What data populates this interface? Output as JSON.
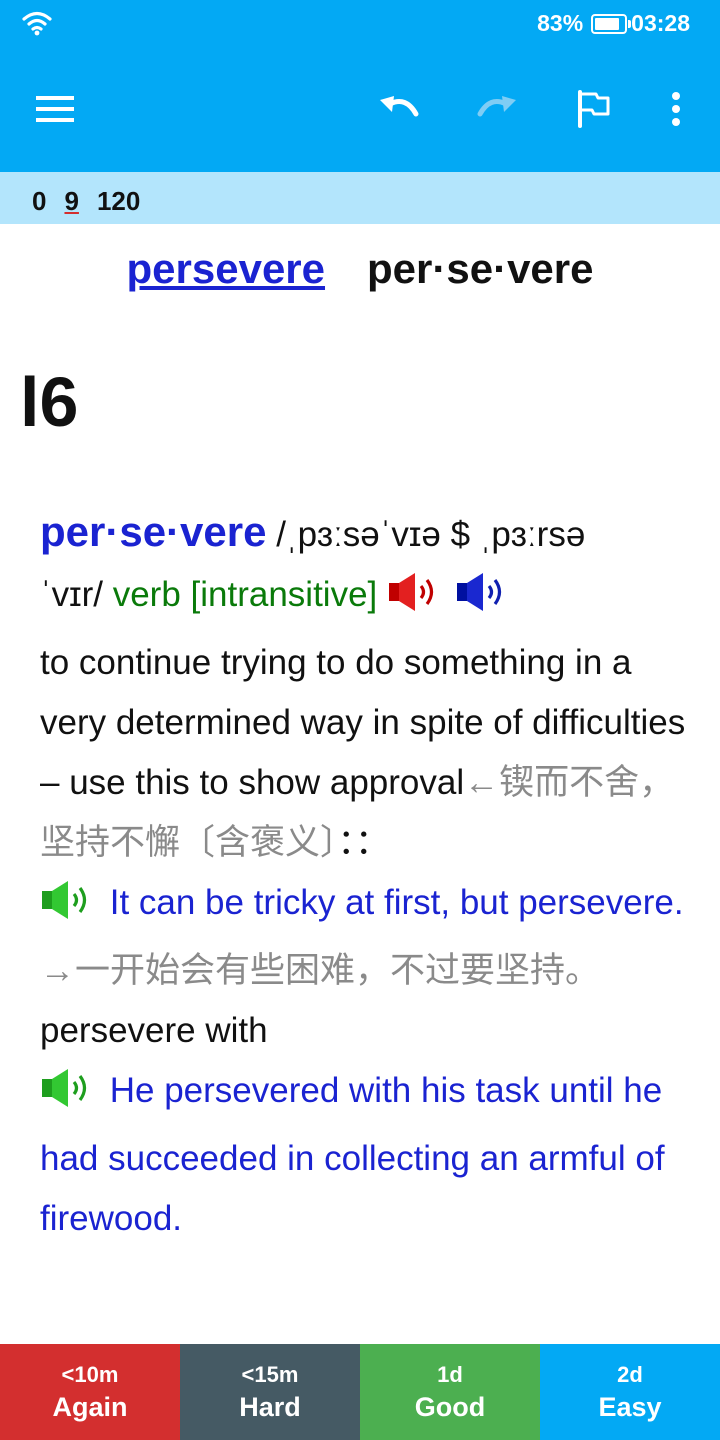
{
  "status": {
    "battery_percent": "83%",
    "battery_level": 0.83,
    "time": "03:28"
  },
  "toolbar": {
    "icons": [
      "menu-icon",
      "undo-icon",
      "redo-icon",
      "flag-icon",
      "more-vert-icon"
    ],
    "accent_color": "#03a9f4"
  },
  "counts": {
    "new": "0",
    "learning": "9",
    "review": "120"
  },
  "card": {
    "word": "persevere",
    "word_syllables": "per·se·vere",
    "level": "l6",
    "headword": "per·se·vere",
    "pron_1": " /ˌpɜːsəˈvɪə $ ˌpɜːrsə",
    "pron_2": "ˈvɪr/ ",
    "pos": "verb [intransitive]",
    "definition": "to continue trying to do something in a very determined way in spite of difficulties – use this to show approval",
    "definition_cn": "←锲而不舍，坚持不懈〔含褒义〕",
    "colons": "：：",
    "example_1": " It can be tricky at first, but persevere.",
    "example_1_cn": "→一开始会有些困难，不过要坚持。",
    "phrase": "persevere with",
    "example_2": " He persevered with his task until he had succeeded in collecting an armful of firewood."
  },
  "answers": [
    {
      "interval": "<10m",
      "label": "Again",
      "color": "#d32f2f"
    },
    {
      "interval": "<15m",
      "label": "Hard",
      "color": "#455a64"
    },
    {
      "interval": "1d",
      "label": "Good",
      "color": "#4caf50"
    },
    {
      "interval": "2d",
      "label": "Easy",
      "color": "#03a9f4"
    }
  ]
}
